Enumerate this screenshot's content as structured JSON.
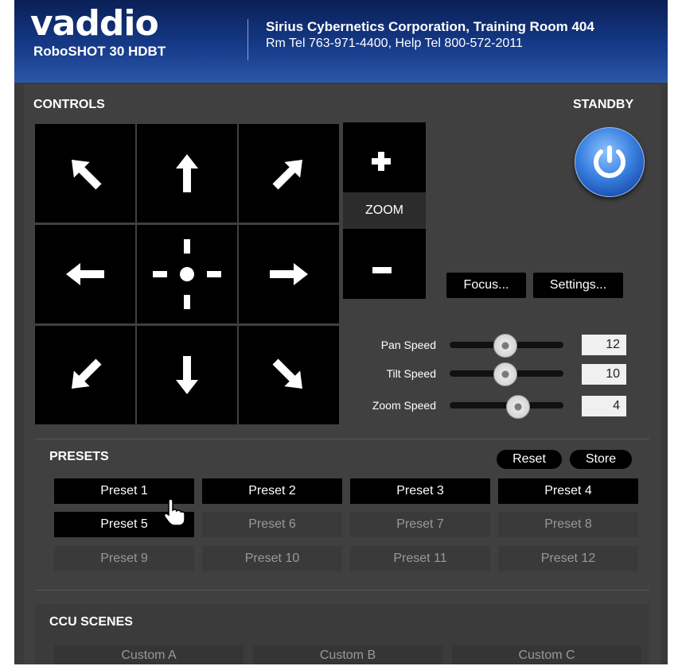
{
  "header": {
    "brand": "vaddio",
    "model": "RoboSHOT 30 HDBT",
    "org_line1": "Sirius Cybernetics Corporation, Training Room 404",
    "org_line2": "Rm Tel 763-971-4400, Help Tel 800-572-2011"
  },
  "controls": {
    "title": "CONTROLS",
    "zoom_label": "ZOOM",
    "focus_label": "Focus...",
    "settings_label": "Settings..."
  },
  "standby": {
    "label": "STANDBY"
  },
  "sliders": [
    {
      "label": "Pan Speed",
      "value": "12",
      "fraction": 0.47
    },
    {
      "label": "Tilt Speed",
      "value": "10",
      "fraction": 0.47
    },
    {
      "label": "Zoom Speed",
      "value": "4",
      "fraction": 0.58
    }
  ],
  "presets": {
    "title": "PRESETS",
    "reset_label": "Reset",
    "store_label": "Store",
    "items": [
      {
        "label": "Preset 1",
        "active": true
      },
      {
        "label": "Preset 2",
        "active": true
      },
      {
        "label": "Preset 3",
        "active": true
      },
      {
        "label": "Preset 4",
        "active": true
      },
      {
        "label": "Preset 5",
        "active": true
      },
      {
        "label": "Preset 6",
        "active": false
      },
      {
        "label": "Preset 7",
        "active": false
      },
      {
        "label": "Preset 8",
        "active": false
      },
      {
        "label": "Preset 9",
        "active": false
      },
      {
        "label": "Preset 10",
        "active": false
      },
      {
        "label": "Preset 11",
        "active": false
      },
      {
        "label": "Preset 12",
        "active": false
      }
    ]
  },
  "ccu": {
    "title": "CCU SCENES",
    "items": [
      "Custom A",
      "Custom B",
      "Custom C"
    ]
  },
  "colors": {
    "header_blue": "#153a88",
    "panel_gray": "#404040",
    "standby_blue": "#3b82e0"
  }
}
